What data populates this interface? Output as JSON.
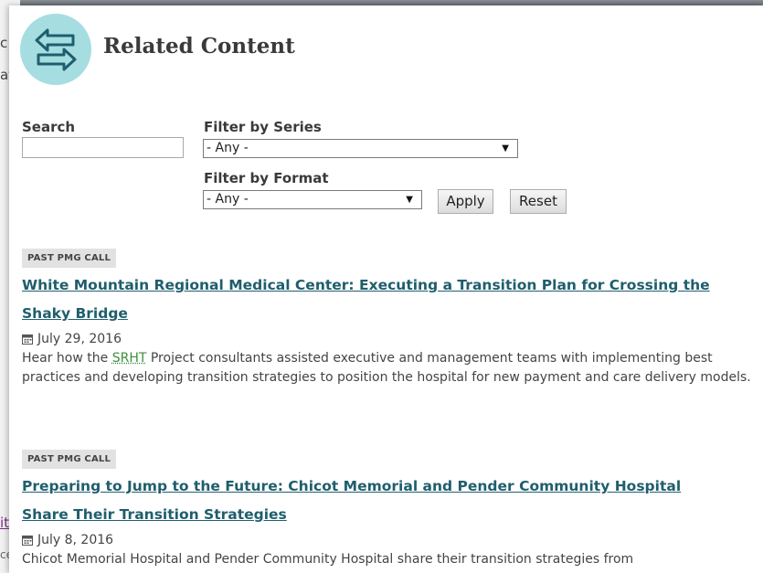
{
  "background": {
    "fragments": [
      "c",
      "at",
      "it",
      "ce"
    ]
  },
  "header": {
    "title": "Related Content",
    "icon": "exchange-arrows-icon",
    "icon_bg": "#a6dde1",
    "icon_color": "#1f5e6d"
  },
  "filters": {
    "search_label": "Search",
    "search_value": "",
    "series_label": "Filter by Series",
    "series_value": "- Any -",
    "format_label": "Filter by Format",
    "format_value": "- Any -",
    "apply_label": "Apply",
    "reset_label": "Reset"
  },
  "items": [
    {
      "badge": "PAST PMG CALL",
      "title_line1": "White Mountain Regional Medical Center: Executing a Transition Plan for Crossing the",
      "title_line2": "Shaky Bridge",
      "date": "July 29, 2016",
      "desc_pre": "Hear how the ",
      "desc_abbr": "SRHT",
      "desc_post": " Project consultants assisted executive and management teams with implementing best practices and developing transition strategies to position the hospital for new payment and care delivery models."
    },
    {
      "badge": "PAST PMG CALL",
      "title_line1": "Preparing to Jump to the Future: Chicot Memorial and Pender Community Hospital",
      "title_line2": "Share Their Transition Strategies",
      "date": "July 8, 2016",
      "desc": "Chicot Memorial Hospital and Pender Community Hospital share their transition strategies from"
    }
  ],
  "colors": {
    "link": "#1f5e6d",
    "abbr": "#3c8f3c",
    "badge_bg": "#e2e2e2"
  }
}
